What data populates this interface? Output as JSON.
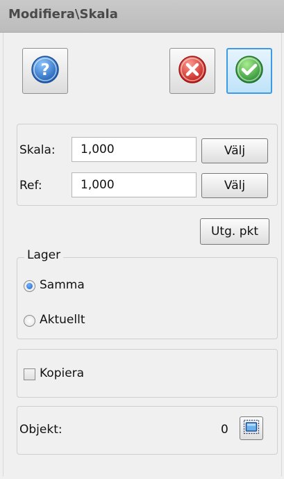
{
  "window": {
    "title": "Modifiera\\Skala"
  },
  "toolbar": {
    "help_icon": "help-icon",
    "cancel_icon": "cancel-icon",
    "ok_icon": "ok-icon"
  },
  "scale_group": {
    "scale_label": "Skala:",
    "scale_value": "1,000",
    "scale_choose": "Välj",
    "ref_label": "Ref:",
    "ref_value": "1,000",
    "ref_choose": "Välj"
  },
  "origin_button": "Utg. pkt",
  "layer_group": {
    "legend": "Lager",
    "options": [
      {
        "label": "Samma",
        "selected": true
      },
      {
        "label": "Aktuellt",
        "selected": false
      }
    ]
  },
  "copy": {
    "label": "Kopiera",
    "checked": false
  },
  "objects": {
    "label": "Objekt:",
    "count": "0",
    "select_icon": "select-window-icon"
  },
  "colors": {
    "accent": "#3c9ae8",
    "help": "#2f74c0",
    "cancel": "#d9342b",
    "ok": "#37a84a"
  }
}
